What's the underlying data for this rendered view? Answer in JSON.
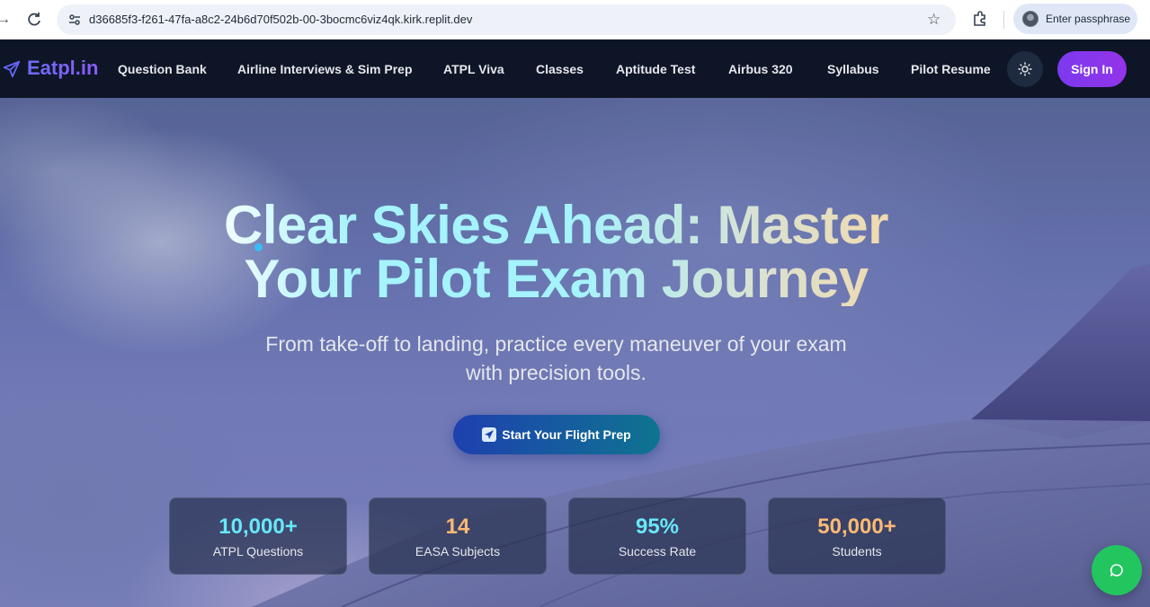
{
  "browser": {
    "url": "d36685f3-f261-47fa-a8c2-24b6d70f502b-00-3bocmc6viz4qk.kirk.replit.dev",
    "profile_label": "Enter passphrase"
  },
  "header": {
    "logo": "Eatpl.in",
    "nav": [
      "Question Bank",
      "Airline Interviews & Sim Prep",
      "ATPL Viva",
      "Classes",
      "Aptitude Test",
      "Airbus 320",
      "Syllabus",
      "Pilot Resume"
    ],
    "sign_in": "Sign In"
  },
  "hero": {
    "headline_line1": "Clear Skies Ahead: Master",
    "headline_line2": "Your Pilot Exam Journey",
    "subtitle_line1": "From take-off to landing, practice every maneuver of your exam",
    "subtitle_line2": "with precision tools.",
    "cta": "Start Your Flight Prep"
  },
  "stats": [
    {
      "value": "10,000+",
      "label": "ATPL Questions",
      "color": "#67e8f9"
    },
    {
      "value": "14",
      "label": "EASA Subjects",
      "color": "#fdba74"
    },
    {
      "value": "95%",
      "label": "Success Rate",
      "color": "#67e8f9"
    },
    {
      "value": "50,000+",
      "label": "Students",
      "color": "#fdba74"
    }
  ],
  "colors": {
    "brand": "#6366f1",
    "sign_in": "#7c3aed",
    "chat": "#22c55e"
  },
  "icons": {
    "logo": "airplane-icon",
    "theme": "sun-icon",
    "cta": "airplane-icon",
    "chat": "chat-icon"
  }
}
